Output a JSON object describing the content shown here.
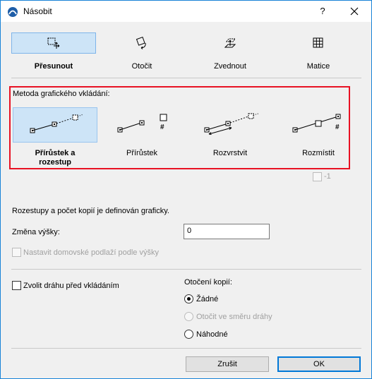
{
  "window": {
    "title": "Násobit",
    "help": "?"
  },
  "tools": [
    {
      "label": "Přesunout",
      "icon": "move-icon"
    },
    {
      "label": "Otočit",
      "icon": "rotate-icon"
    },
    {
      "label": "Zvednout",
      "icon": "elevate-icon"
    },
    {
      "label": "Matice",
      "icon": "matrix-icon"
    }
  ],
  "method": {
    "heading": "Metoda grafického vkládání:",
    "options": [
      {
        "label_line1": "Přírůstek a",
        "label_line2": "rozestup",
        "selected": true
      },
      {
        "label": "Přírůstek"
      },
      {
        "label": "Rozvrstvit"
      },
      {
        "label": "Rozmístit"
      }
    ],
    "minus_one_label": "-1"
  },
  "info_text": "Rozestupy a počet kopií je definován graficky.",
  "elevation": {
    "label": "Změna výšky:",
    "value": "0"
  },
  "home_story_checkbox": {
    "label": "Nastavit domovské podlaží podle výšky",
    "checked": false,
    "disabled": true
  },
  "path_checkbox": {
    "label": "Zvolit dráhu před vkládáním",
    "checked": false
  },
  "rotation": {
    "heading": "Otočení kopií:",
    "options": [
      {
        "label": "Žádné",
        "checked": true,
        "disabled": false
      },
      {
        "label": "Otočit ve směru dráhy",
        "checked": false,
        "disabled": true
      },
      {
        "label": "Náhodné",
        "checked": false,
        "disabled": false
      }
    ]
  },
  "buttons": {
    "cancel": "Zrušit",
    "ok": "OK"
  },
  "colors": {
    "selection": "#cde4f7",
    "highlight_border": "#e81123",
    "accent": "#0078d7"
  }
}
